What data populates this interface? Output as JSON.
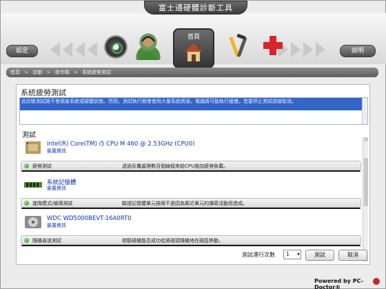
{
  "window": {
    "title": "富士通硬體診斷工具"
  },
  "toolbar": {
    "settings_label": "設定",
    "help_label": "說明",
    "home_label": "首頁"
  },
  "breadcrumb": [
    "首頁",
    ">",
    "診斷",
    ">",
    "指令碼",
    ">",
    "系統疲勞測試"
  ],
  "panel": {
    "title": "系統疲勞測試",
    "description": "此診斷測試將不會損害系統或硬體狀態。然而，測試執行期會使用大量系統資源。電腦將可能執行緩慢。若要停止測試請按取消。",
    "section_title": "測試"
  },
  "devices": [
    {
      "name": "Intel(R) Core(TM) i5 CPU M 460 @ 2.53GHz (CPU0)",
      "sub": "裝置資訊",
      "icon": "cpu-icon",
      "test": {
        "name": "疲勞測試",
        "desc": "透過反覆處理數百個線程來給CPU施加疲勞負載。"
      }
    },
    {
      "name": "系統記憶體",
      "sub": "裝置資訊",
      "icon": "memory-icon",
      "test": {
        "name": "進階模式/循環測試",
        "desc": "驗證記憶體單元損壞不是因為鄰近單元的讀寫活動而造成。"
      }
    },
    {
      "name": "WDC WD5000BEVT-16A0RT0",
      "sub": "裝置資訊",
      "icon": "hard-disk-icon",
      "test": {
        "name": "隨機尋道測試",
        "desc": "檢驗磁機能否成功從將磁頭隨機地在磁區移動。"
      }
    }
  ],
  "controls": {
    "runs_label": "測試運行次數",
    "runs_value": "1",
    "test_button": "測試",
    "cancel_button": "取消"
  },
  "footer": {
    "powered_by": "Powered by PC-Doctor®"
  },
  "colors": {
    "accent": "#3465c9",
    "status_ok": "#2a8a18",
    "link": "#1030b0"
  }
}
